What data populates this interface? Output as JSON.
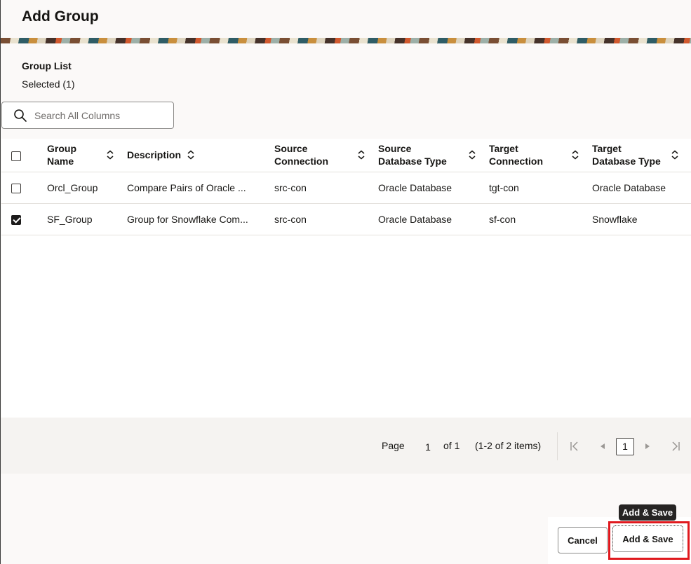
{
  "dialog": {
    "title": "Add Group"
  },
  "group_list": {
    "label": "Group List",
    "selected_text": "Selected (1)"
  },
  "search": {
    "placeholder": "Search All Columns"
  },
  "table": {
    "columns": [
      {
        "key": "group_name",
        "label_line1": "Group",
        "label_line2": "Name"
      },
      {
        "key": "description",
        "label_line1": "Description",
        "label_line2": ""
      },
      {
        "key": "source_connection",
        "label_line1": "Source",
        "label_line2": "Connection"
      },
      {
        "key": "source_database_type",
        "label_line1": "Source",
        "label_line2": "Database Type"
      },
      {
        "key": "target_connection",
        "label_line1": "Target",
        "label_line2": "Connection"
      },
      {
        "key": "target_database_type",
        "label_line1": "Target",
        "label_line2": "Database Type"
      }
    ],
    "rows": [
      {
        "checked": false,
        "group_name": "Orcl_Group",
        "description": "Compare Pairs of Oracle ...",
        "source_connection": "src-con",
        "source_database_type": "Oracle Database",
        "target_connection": "tgt-con",
        "target_database_type": "Oracle Database"
      },
      {
        "checked": true,
        "group_name": "SF_Group",
        "description": "Group for Snowflake Com...",
        "source_connection": "src-con",
        "source_database_type": "Oracle Database",
        "target_connection": "sf-con",
        "target_database_type": "Snowflake"
      }
    ]
  },
  "pagination": {
    "page_label": "Page",
    "page_value": "1",
    "of_text": "of 1",
    "items_text": "(1-2 of 2 items)",
    "current_page": "1"
  },
  "footer": {
    "cancel_label": "Cancel",
    "add_save_label": "Add & Save",
    "tooltip_text": "Add & Save"
  },
  "colors": {
    "highlight": "#e0191e",
    "tooltip_bg": "#262423"
  }
}
